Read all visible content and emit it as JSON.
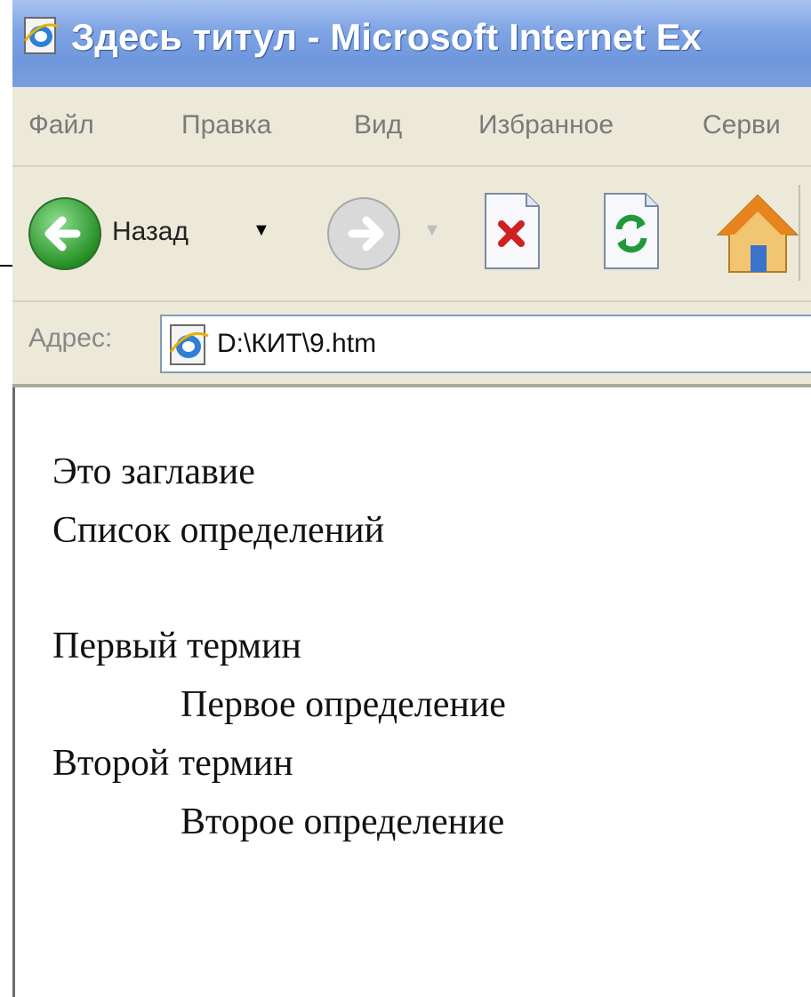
{
  "window": {
    "title": "Здесь титул - Microsoft Internet Ex"
  },
  "menubar": {
    "items": [
      "Файл",
      "Правка",
      "Вид",
      "Избранное",
      "Серви"
    ]
  },
  "toolbar": {
    "back_label": "Назад",
    "icons": [
      "back-arrow-icon",
      "forward-arrow-icon",
      "stop-icon",
      "refresh-icon",
      "home-icon"
    ]
  },
  "address": {
    "label": "Адрес:",
    "value": "D:\\КИТ\\9.htm"
  },
  "content": {
    "heading": "Это заглавие",
    "list_title": "Список определений",
    "term1": "Первый термин",
    "def1": "Первое определение",
    "term2": "Второй термин",
    "def2": "Второе определение"
  },
  "colors": {
    "titlebar": "#7ea4e4",
    "chrome": "#ece9d8",
    "back_green": "#2a9d2a",
    "stop_red": "#d21f1f",
    "refresh_green": "#1f9a3a"
  }
}
